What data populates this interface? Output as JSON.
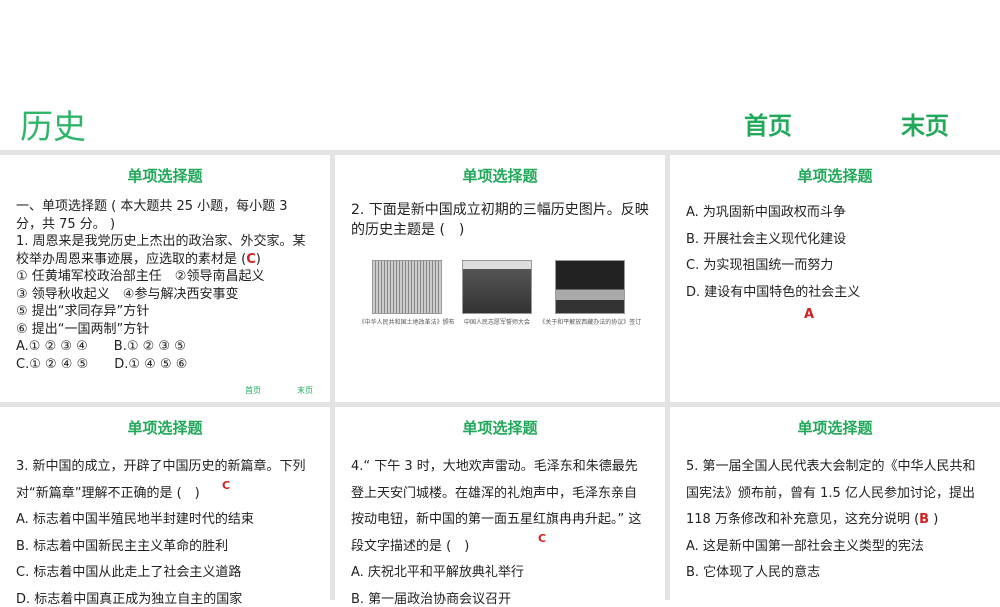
{
  "header": {
    "subject": "历史",
    "first_page": "首页",
    "last_page": "末页"
  },
  "panels": [
    {
      "title": "单项选择题",
      "intro": "一、单项选择题 ( 本大题共 25 小题，每小题 3 分，共 75 分。 )",
      "question": "1. 周恩来是我党历史上杰出的政治家、外交家。某校举办周恩来事迹展，应选取的素材是 (",
      "answer": "C",
      "question_end": ")",
      "items": [
        "① 任黄埔军校政治部主任　②领导南昌起义",
        "③ 领导秋收起义　④参与解决西安事变",
        "⑤ 提出“求同存异”方针",
        "⑥ 提出“一国两制”方针"
      ],
      "options": [
        "A.① ② ③ ④　　B.① ② ③ ⑤",
        "C.① ② ④ ⑤　　D.① ④ ⑤ ⑥"
      ],
      "nav_first": "首页",
      "nav_last": "末页"
    },
    {
      "title": "单项选择题",
      "question": "2. 下面是新中国成立初期的三幅历史图片。反映的历史主题是 (　)",
      "captions": [
        "《中华人民共和国土地改革法》颁布",
        "中国人民志愿军誓师大会",
        "《关于和平解放西藏办法的协议》签订"
      ]
    },
    {
      "title": "单项选择题",
      "options": [
        "A. 为巩固新中国政权而斗争",
        "B. 开展社会主义现代化建设",
        "C. 为实现祖国统一而努力",
        "D. 建设有中国特色的社会主义"
      ],
      "answer": "A"
    },
    {
      "title": "单项选择题",
      "question": "3. 新中国的成立，开辟了中国历史的新篇章。下列对“新篇章”理解不正确的是 (　)",
      "answer": "C",
      "options": [
        "A. 标志着中国半殖民地半封建时代的结束",
        "B. 标志着中国新民主主义革命的胜利",
        "C. 标志着中国从此走上了社会主义道路",
        "D. 标志着中国真正成为独立自主的国家"
      ]
    },
    {
      "title": "单项选择题",
      "question": "4.“ 下午 3 时，大地欢声雷动。毛泽东和朱德最先登上天安门城楼。在雄浑的礼炮声中，毛泽东亲自按动电钮，新中国的第一面五星红旗冉冉升起。” 这段文字描述的是 (　)",
      "answer": "C",
      "options": [
        "A. 庆祝北平和平解放典礼举行",
        "B. 第一届政治协商会议召开"
      ]
    },
    {
      "title": "单项选择题",
      "question": "5. 第一届全国人民代表大会制定的《中华人民共和国宪法》颁布前，曾有 1.5 亿人民参加讨论，提出 118 万条修改和补充意见，这充分说明 (",
      "answer": "B",
      "question_end": ")",
      "options": [
        "A. 这是新中国第一部社会主义类型的宪法",
        "B. 它体现了人民的意志"
      ]
    }
  ]
}
